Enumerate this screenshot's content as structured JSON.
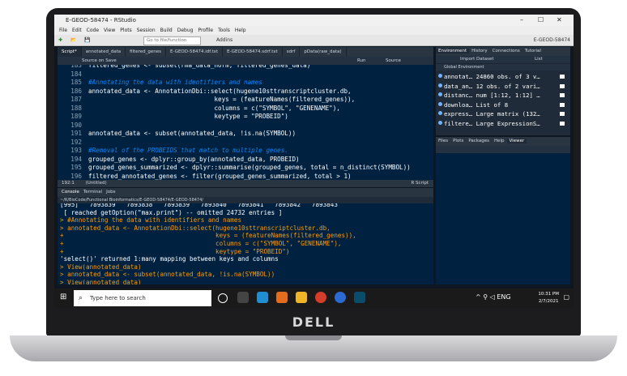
{
  "window": {
    "title": "E-GEOD-58474 - RStudio",
    "project": "E-GEOD-58474"
  },
  "menu": [
    "File",
    "Edit",
    "Code",
    "View",
    "Plots",
    "Session",
    "Build",
    "Debug",
    "Profile",
    "Tools",
    "Help"
  ],
  "toolbar": {
    "goto": "Go to file/function",
    "addins": "Addins"
  },
  "editor": {
    "tabs": [
      "Script*",
      "annotated_data",
      "filtered_genes",
      "E-GEOD-58474.idf.txt",
      "E-GEOD-58474.sdrf.txt",
      "sdrf",
      "pData(raw_data)"
    ],
    "tools": {
      "source_on_save": "Source on Save",
      "run": "Run",
      "source": "Source"
    },
    "lines": [
      {
        "n": "183",
        "t": "filtered_genes <- subset(rma_data_norm, filtered_genes_data)",
        "c": "out"
      },
      {
        "n": "184",
        "t": "",
        "c": "out"
      },
      {
        "n": "185",
        "t": "#Annotating the data with identifiers and names",
        "c": "cm"
      },
      {
        "n": "186",
        "t": "annotated_data <- AnnotationDbi::select(hugene10sttranscriptcluster.db,",
        "c": "out"
      },
      {
        "n": "187",
        "t": "                                  keys = (featureNames(filtered_genes)),",
        "c": "out"
      },
      {
        "n": "188",
        "t": "                                  columns = c(\"SYMBOL\", \"GENENAME\"),",
        "c": "out"
      },
      {
        "n": "189",
        "t": "                                  keytype = \"PROBEID\")",
        "c": "out"
      },
      {
        "n": "190",
        "t": "",
        "c": "out"
      },
      {
        "n": "191",
        "t": "annotated_data <- subset(annotated_data, !is.na(SYMBOL))",
        "c": "out"
      },
      {
        "n": "192",
        "t": "",
        "c": "out"
      },
      {
        "n": "193",
        "t": "#Removal of the PROBEIDS that match to multiple genes.",
        "c": "cm"
      },
      {
        "n": "194",
        "t": "grouped_genes <- dplyr::group_by(annotated_data, PROBEID)",
        "c": "out"
      },
      {
        "n": "195",
        "t": "grouped_genes_summarized <- dplyr::summarise(grouped_genes, total = n_distinct(SYMBOL))",
        "c": "out"
      },
      {
        "n": "196",
        "t": "filtered_annotated_genes <- filter(grouped_genes_summarized, total > 1)",
        "c": "out"
      },
      {
        "n": "197",
        "t": "",
        "c": "out"
      }
    ],
    "status": {
      "position": "192:1",
      "scope": "(Untitled)",
      "type": "R Script"
    }
  },
  "console": {
    "tabs": [
      "Console",
      "Terminal",
      "Jobs"
    ],
    "path": "~/R/BioCode/Functional Bioinformatics/E-GEOD-58474/E-GEOD-58474/",
    "lines": [
      {
        "t": "[995]   7893839   7893838   7893839   7893840   7893841   7893842   7893843",
        "c": "out"
      },
      {
        "t": " [ reached getOption(\"max.print\") -- omitted 24732 entries ]",
        "c": "out"
      },
      {
        "t": "> #Annotating the data with identifiers and names",
        "c": "cmd"
      },
      {
        "t": "> annotated_data <- AnnotationDbi::select(hugene10sttranscriptcluster.db,",
        "c": "cmd"
      },
      {
        "t": "+                                         keys = (featureNames(filtered_genes)),",
        "c": "cmd"
      },
      {
        "t": "+                                         columns = c(\"SYMBOL\", \"GENENAME\"),",
        "c": "cmd"
      },
      {
        "t": "+                                         keytype = \"PROBEID\")",
        "c": "cmd"
      },
      {
        "t": "'select()' returned 1:many mapping between keys and columns",
        "c": "out"
      },
      {
        "t": "> View(annotated_data)",
        "c": "cmd"
      },
      {
        "t": "> annotated_data <- subset(annotated_data, !is.na(SYMBOL))",
        "c": "cmd"
      },
      {
        "t": "> View(annotated_data)",
        "c": "cmd"
      }
    ]
  },
  "environment": {
    "tabs": [
      "Environment",
      "History",
      "Connections",
      "Tutorial"
    ],
    "import": "Import Dataset",
    "list": "List",
    "scope": "Global Environment",
    "rows": [
      {
        "name": "annotat…",
        "value": "24860 obs. of 3 v…"
      },
      {
        "name": "data_an…",
        "value": "12 obs. of 2 vari…"
      },
      {
        "name": "distanc…",
        "value": "num [1:12, 1:12] …"
      },
      {
        "name": "downloa…",
        "value": "List of 8"
      },
      {
        "name": "express…",
        "value": "Large matrix (132…"
      },
      {
        "name": "filtere…",
        "value": "Large ExpressionS…"
      }
    ]
  },
  "files": {
    "tabs": [
      "Files",
      "Plots",
      "Packages",
      "Help",
      "Viewer"
    ]
  },
  "taskbar": {
    "search": "Type here to search",
    "time": "10:31 PM",
    "date": "2/7/2021"
  },
  "laptop": {
    "brand": "DELL"
  }
}
